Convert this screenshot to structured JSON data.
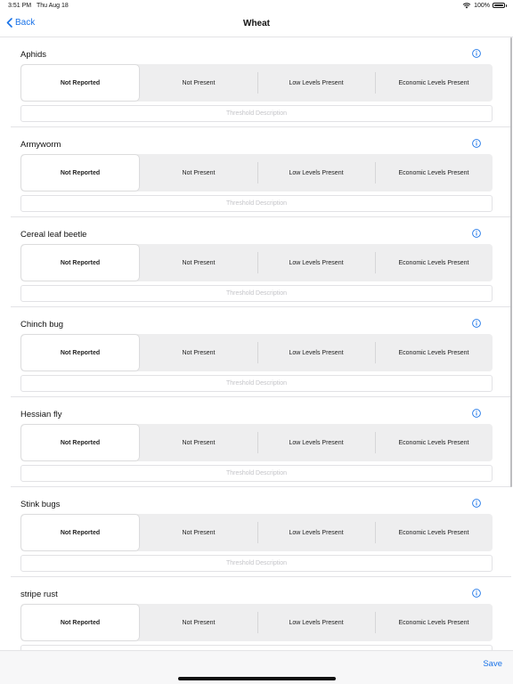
{
  "status_bar": {
    "time": "3:51 PM",
    "date": "Thu Aug 18",
    "battery": "100%",
    "battery_level": 1.0,
    "wifi_icon": "wifi-icon",
    "battery_icon": "battery-icon"
  },
  "nav": {
    "back_label": "Back",
    "back_icon": "chevron-left-icon",
    "title": "Wheat"
  },
  "pests": [
    {
      "name": "Aphids"
    },
    {
      "name": "Armyworm"
    },
    {
      "name": "Cereal leaf beetle"
    },
    {
      "name": "Chinch bug"
    },
    {
      "name": "Hessian fly"
    },
    {
      "name": "Stink bugs"
    },
    {
      "name": "stripe rust"
    }
  ],
  "options": [
    "Not Reported",
    "Not Present",
    "Low Levels Present",
    "Economic Levels Present"
  ],
  "selected_option": "Not Reported",
  "threshold_placeholder": "Threshold Description",
  "info_icon": "info-circle-icon",
  "bottom_bar": {
    "save_label": "Save"
  },
  "colors": {
    "accent": "#1a73e8",
    "segment_bg": "#eeeeef",
    "selected_bg": "#ffffff"
  }
}
